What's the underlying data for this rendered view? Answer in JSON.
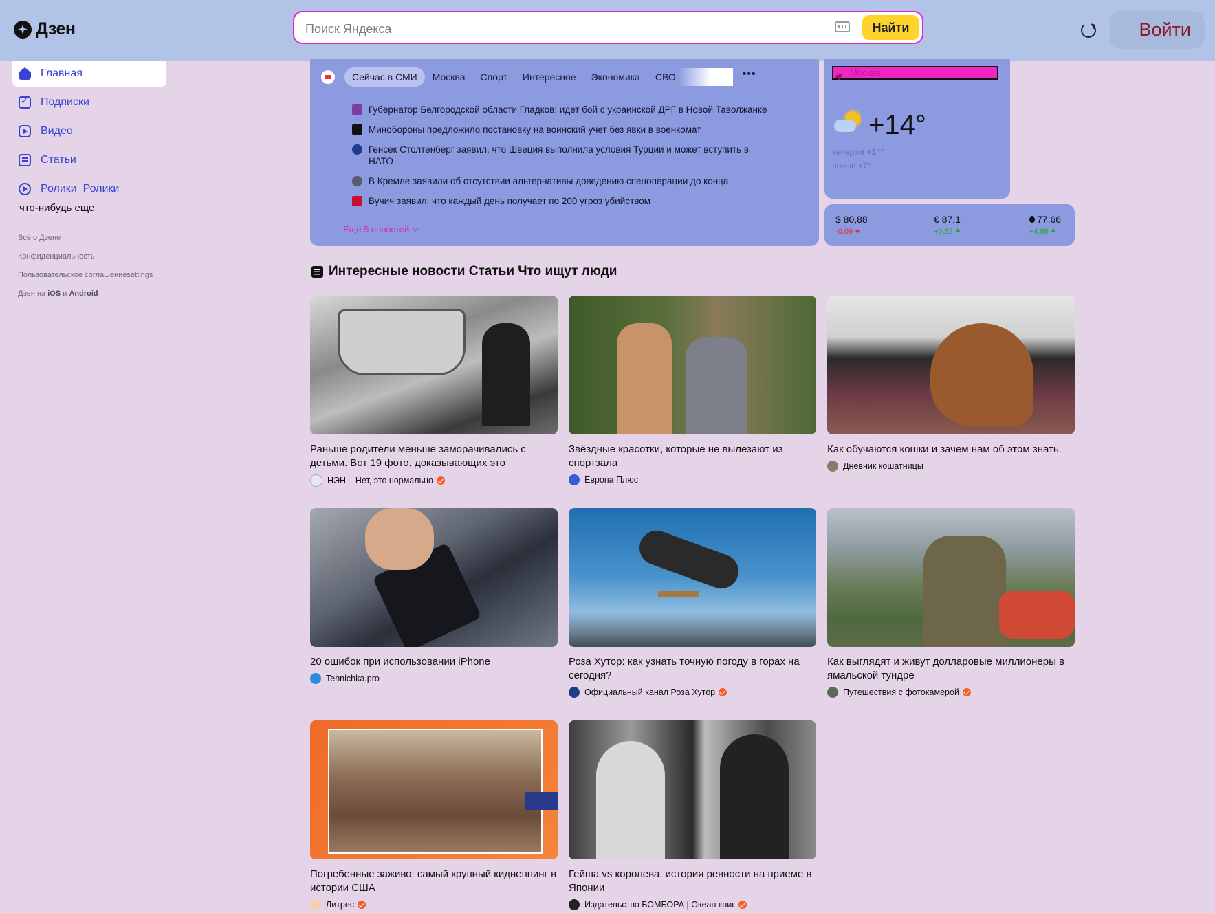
{
  "header": {
    "logo_text": "Дзен",
    "search_placeholder": "Поиск Яндекса",
    "search_button": "Найти",
    "login_button": "Войти"
  },
  "sidebar": {
    "items": [
      {
        "label": "Главная",
        "icon": "home-icon"
      },
      {
        "label": "Подписки",
        "icon": "subscriptions-icon"
      },
      {
        "label": "Видео",
        "icon": "video-icon"
      },
      {
        "label": "Статьи",
        "icon": "articles-icon"
      },
      {
        "label": "Ролики  Ролики",
        "icon": "clips-icon"
      }
    ],
    "extra": "что-нибудь еще",
    "footer_links": [
      "Всё о Дзене",
      "Конфиденциальность",
      "Пользовательское соглашениеsettings"
    ],
    "apps": {
      "prefix": "Дзен на ",
      "ios": "iOS",
      "and": " и ",
      "android": "Android"
    }
  },
  "news": {
    "tabs": [
      "Сейчас в СМИ",
      "Москва",
      "Спорт",
      "Интересное",
      "Экономика",
      "СВО"
    ],
    "more_tabs": "•••",
    "headlines": [
      "Губернатор Белгородской области Гладков: идет бой с украинской ДРГ в Новой Таволжанке",
      "Минобороны предложило постановку на воинский учет без явки в военкомат",
      "Генсек Столтенберг заявил, что Швеция выполнила условия Турции и может вступить в НАТО",
      "В Кремле заявили об отсутствии альтернативы доведению спецоперации до конца",
      "Вучич заявил, что каждый день получает по 200 угроз убийством"
    ],
    "headline_source_colors": [
      "#7b3fa0",
      "#111111",
      "#1f3c8f",
      "#5a5a6a",
      "#c8102e"
    ],
    "more": "Ещё 5 новостей"
  },
  "weather": {
    "city": "Москва",
    "temp": "+14°",
    "evening": "вечером +14°",
    "night": "ночью +7°"
  },
  "currency": [
    {
      "label": "$ 80,88",
      "delta": "-0,09",
      "direction": "down"
    },
    {
      "label": "€ 87,1",
      "delta": "+0,52",
      "direction": "up"
    },
    {
      "label": "77,66",
      "delta": "+4,98",
      "direction": "up"
    }
  ],
  "feed": {
    "title": "Интересные новости Статьи Что ищут люди",
    "cards": [
      {
        "title": "Раньше родители меньше заморачивались с детьми. Вот 19 фото, доказывающих это",
        "source": "НЭН – Нет, это нормально",
        "verified": true
      },
      {
        "title": "Звёздные красотки, которые не вылезают из спортзала",
        "source": "Европа Плюс",
        "verified": false
      },
      {
        "title": "Как обучаются кошки и зачем нам об этом знать.",
        "source": "Дневник кошатницы",
        "verified": false
      },
      {
        "title": "20 ошибок при использовании iPhone",
        "source": "Tehnichka.pro",
        "verified": false
      },
      {
        "title": "Роза Хутор: как узнать точную погоду в горах на сегодня?",
        "source": "Официальный канал Роза Хутор",
        "verified": true
      },
      {
        "title": "Как выглядят и живут долларовые миллионеры в ямальской тундре",
        "source": "Путешествия с фотокамерой",
        "verified": true
      },
      {
        "title": "Погребенные заживо: самый крупный киднеппинг в истории США",
        "source": "Литрес",
        "verified": true
      },
      {
        "title": "Гейша vs королева: история ревности на приеме в Японии",
        "source": "Издательство БОМБОРА | Океан книг",
        "verified": true
      }
    ]
  },
  "colors": {
    "header_bg": "#b1c3e6",
    "page_bg": "#e5d3e8",
    "widget_bg": "#8c9ae0",
    "accent_link": "#3743d3",
    "search_border": "#e128c6",
    "search_button": "#ffd42a",
    "verified_badge": "#f45d2a"
  }
}
